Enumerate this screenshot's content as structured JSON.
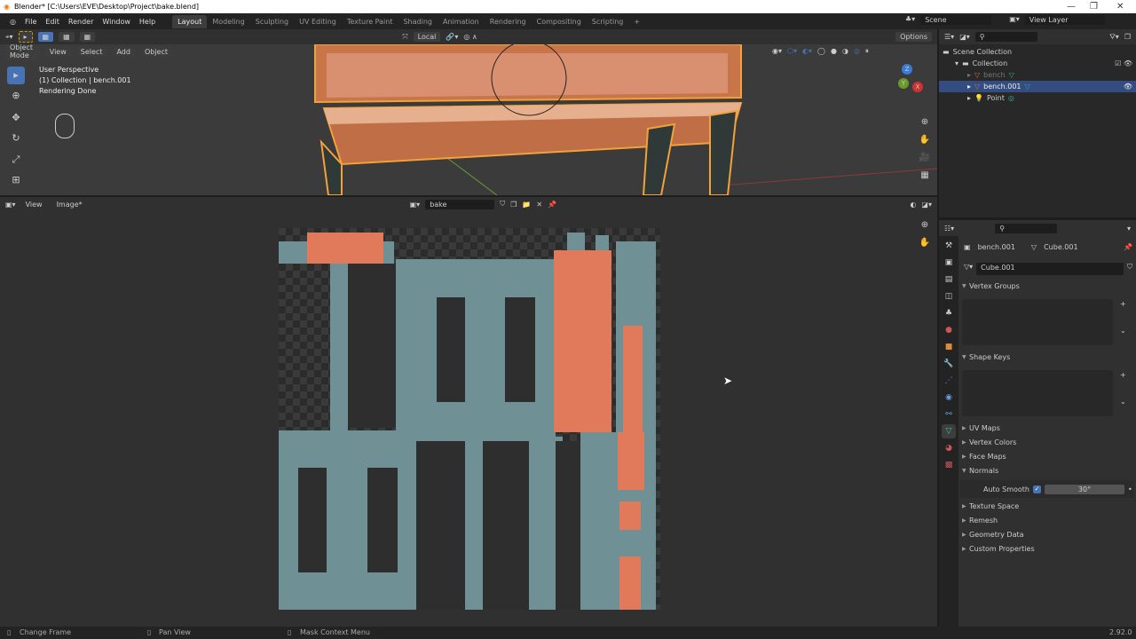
{
  "window": {
    "title": "Blender* [C:\\Users\\EVE\\Desktop\\Project\\bake.blend]",
    "minimize": "—",
    "maximize": "❐",
    "close": "✕"
  },
  "menu": [
    "File",
    "Edit",
    "Render",
    "Window",
    "Help"
  ],
  "workspaces": [
    {
      "label": "Layout",
      "active": true
    },
    {
      "label": "Modeling"
    },
    {
      "label": "Sculpting"
    },
    {
      "label": "UV Editing"
    },
    {
      "label": "Texture Paint"
    },
    {
      "label": "Shading"
    },
    {
      "label": "Animation"
    },
    {
      "label": "Rendering"
    },
    {
      "label": "Compositing"
    },
    {
      "label": "Scripting"
    }
  ],
  "add_workspace": "+",
  "scene": {
    "label": "Scene",
    "view_layer": "View Layer"
  },
  "toolheader": {
    "orientation": "Local",
    "options": "Options"
  },
  "viewport": {
    "mode": "Object Mode",
    "menus": [
      "View",
      "Select",
      "Add",
      "Object"
    ],
    "overlay": [
      "User Perspective",
      "(1) Collection | bench.001",
      "Rendering Done"
    ],
    "gizmo": {
      "x": "X",
      "y": "Y",
      "z": "Z"
    }
  },
  "image_editor": {
    "menus": [
      "View",
      "Image*"
    ],
    "image_name": "bake"
  },
  "outliner": {
    "items": [
      {
        "label": "Scene Collection",
        "level": 0
      },
      {
        "label": "Collection",
        "level": 1
      },
      {
        "label": "bench",
        "level": 2,
        "dim": true
      },
      {
        "label": "bench.001",
        "level": 2,
        "selected": true
      },
      {
        "label": "Point",
        "level": 2
      }
    ]
  },
  "properties": {
    "object": "bench.001",
    "mesh": "Cube.001",
    "datablock": "Cube.001",
    "sections": [
      {
        "label": "Vertex Groups",
        "open": true
      },
      {
        "label": "Shape Keys",
        "open": true
      },
      {
        "label": "UV Maps"
      },
      {
        "label": "Vertex Colors"
      },
      {
        "label": "Face Maps"
      },
      {
        "label": "Normals",
        "open": true
      },
      {
        "label": "Texture Space"
      },
      {
        "label": "Remesh"
      },
      {
        "label": "Geometry Data"
      },
      {
        "label": "Custom Properties"
      }
    ],
    "auto_smooth_label": "Auto Smooth",
    "auto_smooth_checked": true,
    "auto_smooth_angle": "30°"
  },
  "status": {
    "left": "Change Frame",
    "middle": "Pan View",
    "right": "Mask Context Menu",
    "version": "2.92.0"
  },
  "colors": {
    "accent": "#4772b3",
    "bake_teal": "#6f9094",
    "bake_orange": "#e07a5a",
    "wood": "#c8754a",
    "selection": "#f3a13a"
  }
}
